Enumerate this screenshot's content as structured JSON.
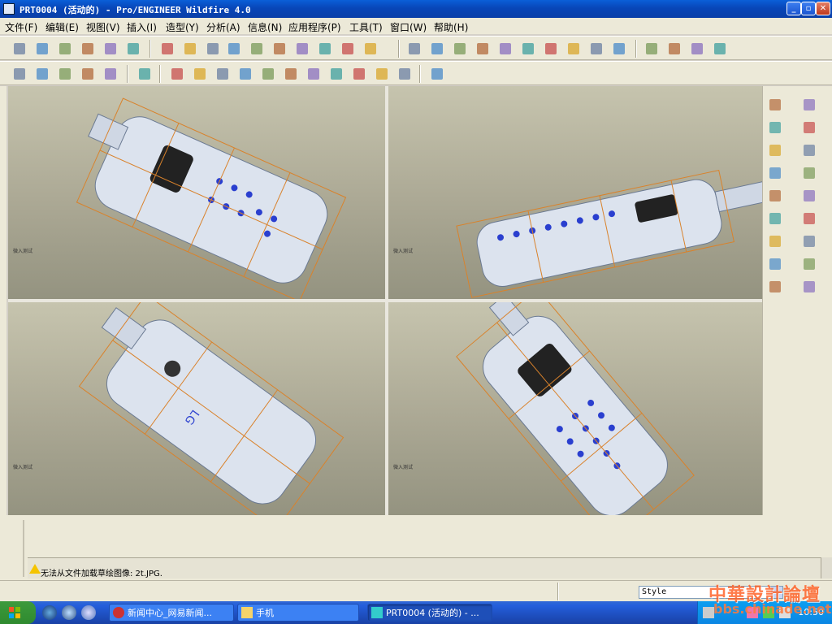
{
  "window": {
    "title": "PRT0004 (活动的) - Pro/ENGINEER Wildfire 4.0",
    "buttons": [
      "minimize",
      "maximize",
      "close"
    ]
  },
  "menubar": {
    "items": [
      {
        "label": "文件(F)"
      },
      {
        "label": "编辑(E)"
      },
      {
        "label": "视图(V)"
      },
      {
        "label": "插入(I)"
      },
      {
        "label": "造型(Y)"
      },
      {
        "label": "分析(A)"
      },
      {
        "label": "信息(N)"
      },
      {
        "label": "应用程序(P)"
      },
      {
        "label": "工具(T)"
      },
      {
        "label": "窗口(W)"
      },
      {
        "label": "帮助(H)"
      }
    ]
  },
  "toolbar1": {
    "icons": [
      "new-icon",
      "open-icon",
      "save-icon",
      "print-icon",
      "email-icon",
      "email-link-icon",
      "undo-icon",
      "redo-icon",
      "regenerate-icon",
      "cut-icon",
      "copy-icon",
      "paste-icon",
      "paste-special-icon",
      "traffic-light-icon",
      "find-icon",
      "select-box-icon",
      "repaint-icon",
      "spin-center-icon",
      "orient-icon",
      "zoom-in-icon",
      "zoom-out-icon",
      "refit-icon",
      "reorient-icon",
      "saved-views-icon",
      "layers-icon",
      "view-manager-icon",
      "wireframe-icon",
      "hidden-line-icon",
      "no-hidden-icon",
      "shading-icon"
    ]
  },
  "toolbar2": {
    "icons": [
      "datum-plane-display-icon",
      "datum-axis-display-icon",
      "datum-point-display-icon",
      "coordinate-system-display-icon",
      "annotation-display-icon",
      "isometric-view-icon",
      "curvature-icon",
      "section-icon",
      "offset-icon",
      "draft-icon",
      "reflection-icon",
      "slope-icon",
      "shade-analysis-icon",
      "curve-analysis-icon",
      "surface-analysis-icon",
      "delete-analysis-icon",
      "delete-all-icon",
      "context-help-icon"
    ]
  },
  "viewports": {
    "label": "微入测试"
  },
  "palette": {
    "icons": [
      "select-arrow-icon",
      "surface-curve-icon",
      "plane-tool-icon",
      "plane-icon",
      "curve-tool-icon",
      "axis-icon",
      "sketch-tool-icon",
      "spline-icon",
      "boundary-surface-icon",
      "point-icon",
      "surface-icon",
      "coordinate-icon",
      "trim-icon",
      "point-offset-icon",
      "surface-edit-icon",
      "link-icon",
      "style-edit-icon",
      "ok-check-icon"
    ]
  },
  "message": {
    "text": "无法从文件加载草绘图像: 2t.JPG."
  },
  "statusbar": {
    "filter_value": "Style"
  },
  "taskbar": {
    "tasks": [
      {
        "label": "新闻中心_网易新闻..."
      },
      {
        "label": "手机"
      },
      {
        "label": "PRT0004 (活动的) - ..."
      }
    ],
    "clock": "10:50"
  },
  "watermark": {
    "line1": "中華設計論壇",
    "line2": "bbs.chinade.net"
  },
  "colors": {
    "titlebar": "#0a5fd8",
    "viewport": "#b1ae9a",
    "datum_orange": "#d9822b",
    "keypad_blue": "#2a3fcf"
  }
}
